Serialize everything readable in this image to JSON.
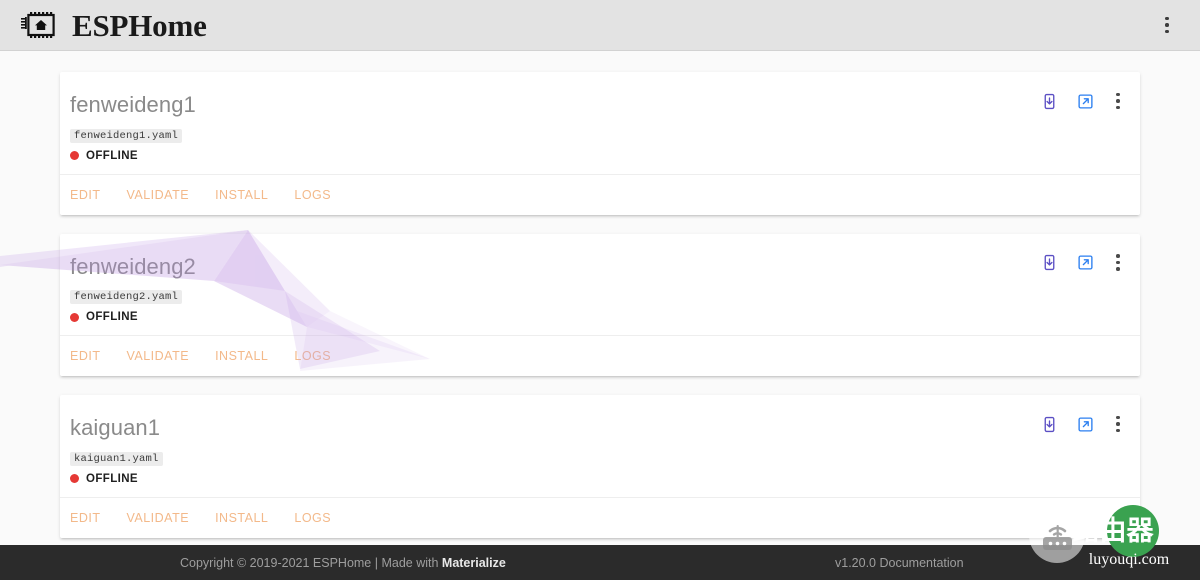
{
  "navbar": {
    "brand_title": "ESPHome",
    "logo_icon": "esphome-chip-house-icon",
    "menu_icon": "kebab-menu-icon"
  },
  "devices": [
    {
      "name": "fenweideng1",
      "file": "fenweideng1.yaml",
      "status": "OFFLINE",
      "status_color": "#e53935",
      "actions": [
        "EDIT",
        "VALIDATE",
        "INSTALL",
        "LOGS"
      ],
      "icons": [
        "install-to-device-icon",
        "open-in-new-icon",
        "kebab-menu-icon"
      ]
    },
    {
      "name": "fenweideng2",
      "file": "fenweideng2.yaml",
      "status": "OFFLINE",
      "status_color": "#e53935",
      "actions": [
        "EDIT",
        "VALIDATE",
        "INSTALL",
        "LOGS"
      ],
      "icons": [
        "install-to-device-icon",
        "open-in-new-icon",
        "kebab-menu-icon"
      ]
    },
    {
      "name": "kaiguan1",
      "file": "kaiguan1.yaml",
      "status": "OFFLINE",
      "status_color": "#e53935",
      "actions": [
        "EDIT",
        "VALIDATE",
        "INSTALL",
        "LOGS"
      ],
      "icons": [
        "install-to-device-icon",
        "open-in-new-icon",
        "kebab-menu-icon"
      ]
    }
  ],
  "footer": {
    "copyright_prefix": "Copyright © 2019-2021 ESPHome | Made with ",
    "made_with": "Materialize",
    "version_link": "v1.20.0 Documentation"
  },
  "watermark": {
    "cn_text": "路由器",
    "domain_text": "luyouqi.com",
    "router_icon": "router-icon"
  },
  "colors": {
    "action_link": "#f3b98a",
    "navbar_bg": "#e3e3e3",
    "page_bg": "#fafafa",
    "footer_bg": "#2b2b2b",
    "card_title": "#8a8a8a",
    "install_icon": "#5b4fc4",
    "open_icon": "#2b7ff0"
  }
}
